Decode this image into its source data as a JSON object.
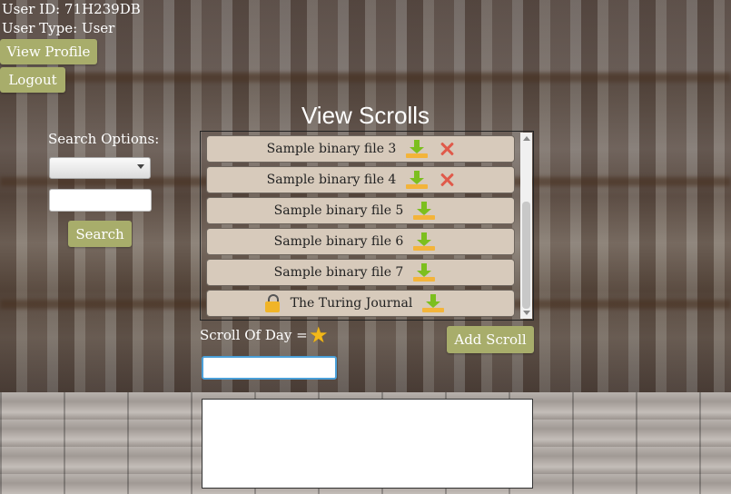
{
  "user": {
    "id_line": "User ID: 71H239DB",
    "type_line": "User Type: User"
  },
  "buttons": {
    "view_profile": "View Profile",
    "logout": "Logout",
    "search": "Search",
    "add_scroll": "Add Scroll"
  },
  "page_title": "View Scrolls",
  "search": {
    "label": "Search Options:",
    "select_value": "",
    "input_value": ""
  },
  "scrolls": [
    {
      "label": "Sample binary file 3",
      "icons": [
        "download-icon",
        "delete-icon"
      ]
    },
    {
      "label": "Sample binary file 4",
      "icons": [
        "download-icon",
        "delete-icon"
      ]
    },
    {
      "label": "Sample binary file 5",
      "icons": [
        "download-icon"
      ]
    },
    {
      "label": "Sample binary file 6",
      "icons": [
        "download-icon"
      ]
    },
    {
      "label": "Sample binary file 7",
      "icons": [
        "download-icon"
      ]
    },
    {
      "label": "The Turing Journal",
      "icons": [
        "lock-icon",
        "download-icon"
      ]
    }
  ],
  "scroll_of_day": {
    "label": "Scroll Of Day =",
    "icon": "star-icon",
    "input_value": ""
  },
  "colors": {
    "button": "#a8ad6b",
    "list_item": "#d7cabb",
    "download_arrow": "#7cbf1e",
    "delete_x": "#e05a4a",
    "star": "#f2b81a"
  }
}
